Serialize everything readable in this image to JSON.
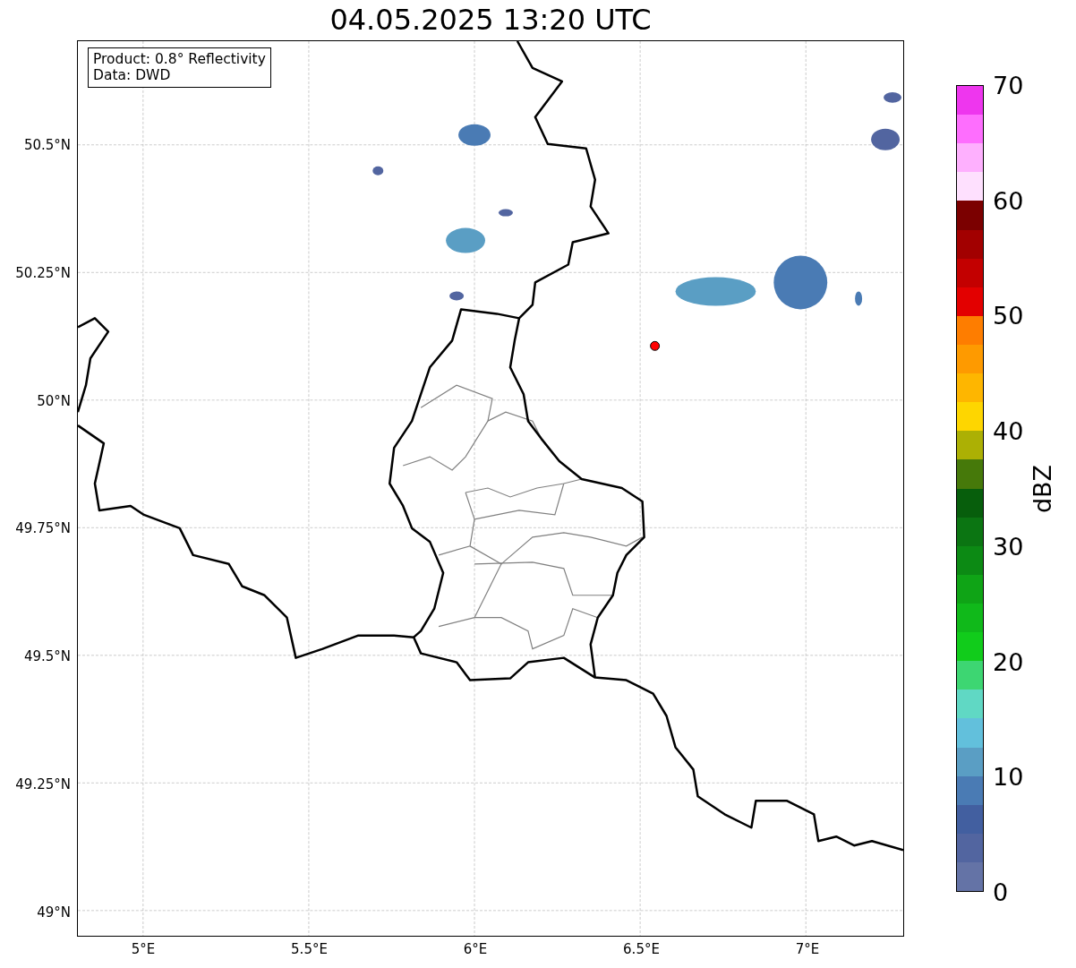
{
  "title": "04.05.2025 13:20 UTC",
  "info_box": [
    "Product: 0.8° Reflectivity",
    "Data: DWD"
  ],
  "map": {
    "lat_ticks": [
      "50.5°N",
      "50.25°N",
      "50°N",
      "49.75°N",
      "49.5°N",
      "49.25°N",
      "49°N"
    ],
    "lon_ticks": [
      "5°E",
      "5.5°E",
      "6°E",
      "6.5°E",
      "7°E"
    ]
  },
  "colorbar": {
    "label": "dBZ",
    "ticks": [
      "70",
      "60",
      "50",
      "40",
      "30",
      "20",
      "10",
      "0"
    ],
    "bins": [
      {
        "color": "#ee36ee"
      },
      {
        "color": "#fe6efe"
      },
      {
        "color": "#feb0fe"
      },
      {
        "color": "#fee0fe"
      },
      {
        "color": "#7b0000"
      },
      {
        "color": "#a20000"
      },
      {
        "color": "#c30000"
      },
      {
        "color": "#e30000"
      },
      {
        "color": "#fe7d00"
      },
      {
        "color": "#fe9a00"
      },
      {
        "color": "#feb600"
      },
      {
        "color": "#fed600"
      },
      {
        "color": "#acb004"
      },
      {
        "color": "#46790a"
      },
      {
        "color": "#075e0c"
      },
      {
        "color": "#0b7512"
      },
      {
        "color": "#0c8a14"
      },
      {
        "color": "#0fa416"
      },
      {
        "color": "#10b91a"
      },
      {
        "color": "#11cc1b"
      },
      {
        "color": "#3dd672"
      },
      {
        "color": "#60d8c4"
      },
      {
        "color": "#62c0dc"
      },
      {
        "color": "#5a9ec4"
      },
      {
        "color": "#4a7bb4"
      },
      {
        "color": "#425fa0"
      },
      {
        "color": "#5265a0"
      },
      {
        "color": "#6473a6"
      }
    ]
  }
}
